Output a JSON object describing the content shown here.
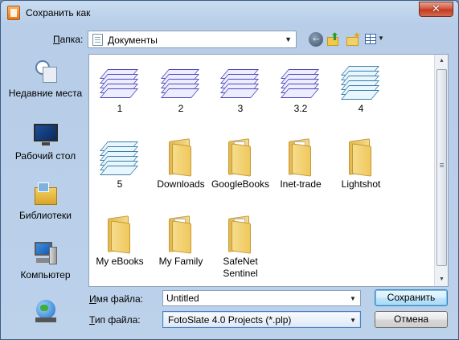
{
  "window": {
    "title": "Сохранить как",
    "close_label": "✕"
  },
  "toolbar": {
    "folder_label_prefix": "П",
    "folder_label_rest": "апка:",
    "folder_value": "Документы"
  },
  "places": [
    {
      "name": "recent",
      "label": "Недавние места"
    },
    {
      "name": "desktop",
      "label": "Рабочий стол"
    },
    {
      "name": "libraries",
      "label": "Библиотеки"
    },
    {
      "name": "computer",
      "label": "Компьютер"
    },
    {
      "name": "network",
      "label": ""
    }
  ],
  "files": {
    "items": [
      {
        "label": "1",
        "icon": "stack-icon"
      },
      {
        "label": "2",
        "icon": "stack-icon"
      },
      {
        "label": "3",
        "icon": "stack-icon"
      },
      {
        "label": "3.2",
        "icon": "stack-icon"
      },
      {
        "label": "4",
        "icon": "stack-blue-icon"
      },
      {
        "label": "5",
        "icon": "stack-blue-icon"
      },
      {
        "label": "Downloads",
        "icon": "folder-icon"
      },
      {
        "label": "GoogleBooks",
        "icon": "folder-icon"
      },
      {
        "label": "Inet-trade",
        "icon": "folder-icon"
      },
      {
        "label": "Lightshot",
        "icon": "folder-icon"
      },
      {
        "label": "My eBooks",
        "icon": "folder-icon"
      },
      {
        "label": "My Family",
        "icon": "folder-icon"
      },
      {
        "label": "SafeNet Sentinel",
        "icon": "folder-icon"
      }
    ]
  },
  "form": {
    "filename_label_prefix": "И",
    "filename_label_rest": "мя файла:",
    "filename_value": "Untitled",
    "filetype_label_prefix": "Т",
    "filetype_label_rest": "ип файла:",
    "filetype_value": "FotoSlate 4.0 Projects (*.plp)",
    "save_label": "Сохранить",
    "cancel_label": "Отмена"
  },
  "colors": {
    "accent": "#3c7fb1",
    "window_bg": "#bcd1ea",
    "close": "#c23b22"
  }
}
